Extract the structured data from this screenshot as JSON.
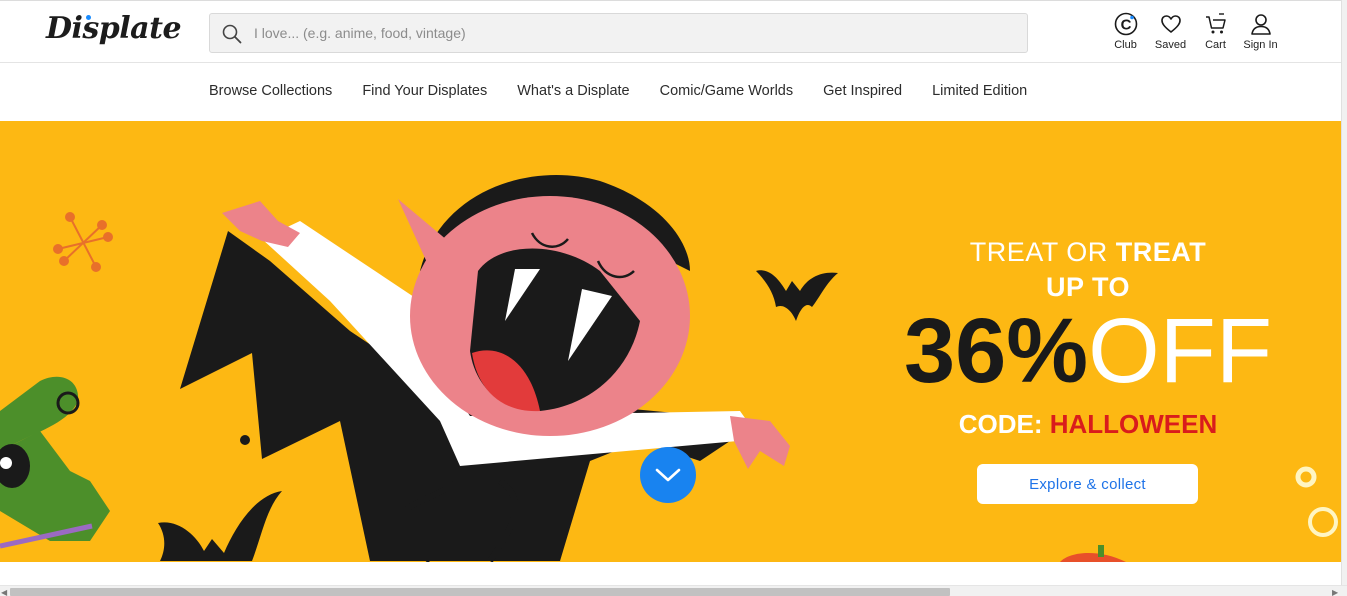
{
  "header": {
    "logo_text": "Displate",
    "search_placeholder": "I love... (e.g. anime, food, vintage)",
    "actions": [
      {
        "label": "Club",
        "icon": "club-icon"
      },
      {
        "label": "Saved",
        "icon": "heart-icon"
      },
      {
        "label": "Cart",
        "icon": "cart-icon"
      },
      {
        "label": "Sign In",
        "icon": "user-icon"
      }
    ]
  },
  "nav": {
    "items": [
      "Browse Collections",
      "Find Your Displates",
      "What's a Displate",
      "Comic/Game Worlds",
      "Get Inspired",
      "Limited Edition"
    ]
  },
  "hero": {
    "line1_light": "TREAT OR ",
    "line1_bold": "TREAT",
    "line2": "UP TO",
    "discount": "36%",
    "off": "OFF",
    "code_label": "CODE: ",
    "code_value": "HALLOWEEN",
    "cta_label": "Explore & collect",
    "scroll_icon": "chevron-down-icon",
    "colors": {
      "background": "#fdb813",
      "code": "#d91c1c",
      "cta_text": "#1e73e8",
      "scroll_button": "#1883f0"
    }
  }
}
